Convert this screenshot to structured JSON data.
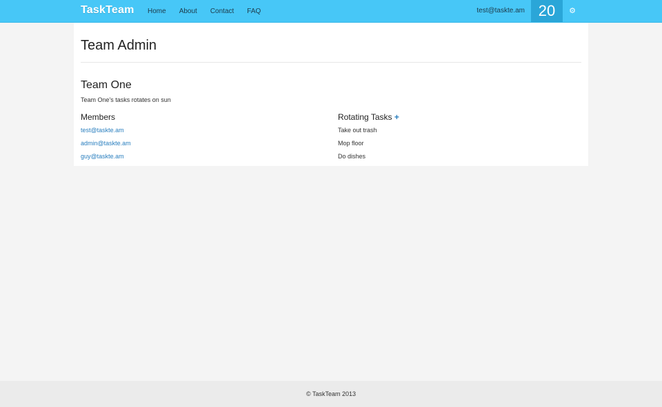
{
  "navbar": {
    "brand": "TaskTeam",
    "links": [
      "Home",
      "About",
      "Contact",
      "FAQ"
    ],
    "user_email": "test@taskte.am",
    "counter": "20",
    "settings_icon": "gear-icon",
    "background": "#47c7f7",
    "counter_background": "#2aa6d8"
  },
  "main": {
    "title": "Team Admin",
    "team": {
      "name": "Team One",
      "description": "Team One's tasks rotates on sun",
      "members_heading": "Members",
      "members": [
        "test@taskte.am",
        "admin@taskte.am",
        "guy@taskte.am"
      ],
      "tasks_heading": "Rotating Tasks",
      "add_task_label": "+",
      "tasks": [
        "Take out trash",
        "Mop floor",
        "Do dishes"
      ]
    }
  },
  "footer": {
    "text": "© TaskTeam 2013"
  },
  "colors": {
    "link": "#2a7fbf",
    "page_background": "#f4f4f4"
  }
}
